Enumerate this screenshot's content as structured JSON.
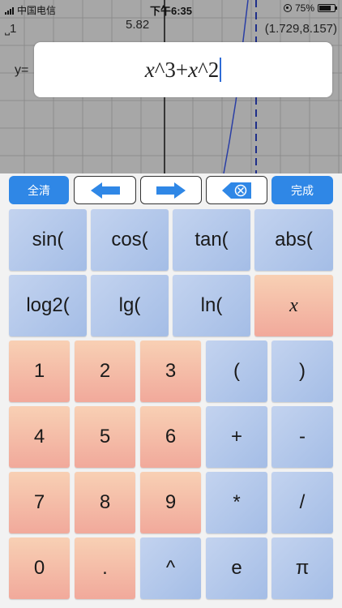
{
  "status_bar": {
    "carrier": "中国电信",
    "time": "下午6:35",
    "battery_percent": "75%",
    "battery_level": 0.75
  },
  "graph": {
    "top_left_label": "⎵1",
    "top_value": "5.82",
    "coordinate": "(1.729,8.157)"
  },
  "input": {
    "label": "y=",
    "expression": [
      {
        "text": "x",
        "var": true
      },
      {
        "text": "^3+",
        "var": false
      },
      {
        "text": "x",
        "var": true
      },
      {
        "text": "^2",
        "var": false
      }
    ]
  },
  "toolbar": {
    "clear_all": "全清",
    "done": "完成",
    "left_arrow_icon": "arrow-left",
    "right_arrow_icon": "arrow-right",
    "backspace_icon": "backspace"
  },
  "keys": [
    [
      "sin(",
      "cos(",
      "tan(",
      "abs("
    ],
    [
      "log2(",
      "lg(",
      "ln(",
      "x"
    ],
    [
      "1",
      "2",
      "3",
      "(",
      ")"
    ],
    [
      "4",
      "5",
      "6",
      "+",
      "-"
    ],
    [
      "7",
      "8",
      "9",
      "*",
      "/"
    ],
    [
      "0",
      ".",
      "^",
      "e",
      "π"
    ]
  ],
  "colors": {
    "accent_blue": "#2f87e6",
    "key_blue": "#b4c8eb",
    "key_orange": "#f4bca6",
    "graph_curve": "#2b3fa5"
  }
}
